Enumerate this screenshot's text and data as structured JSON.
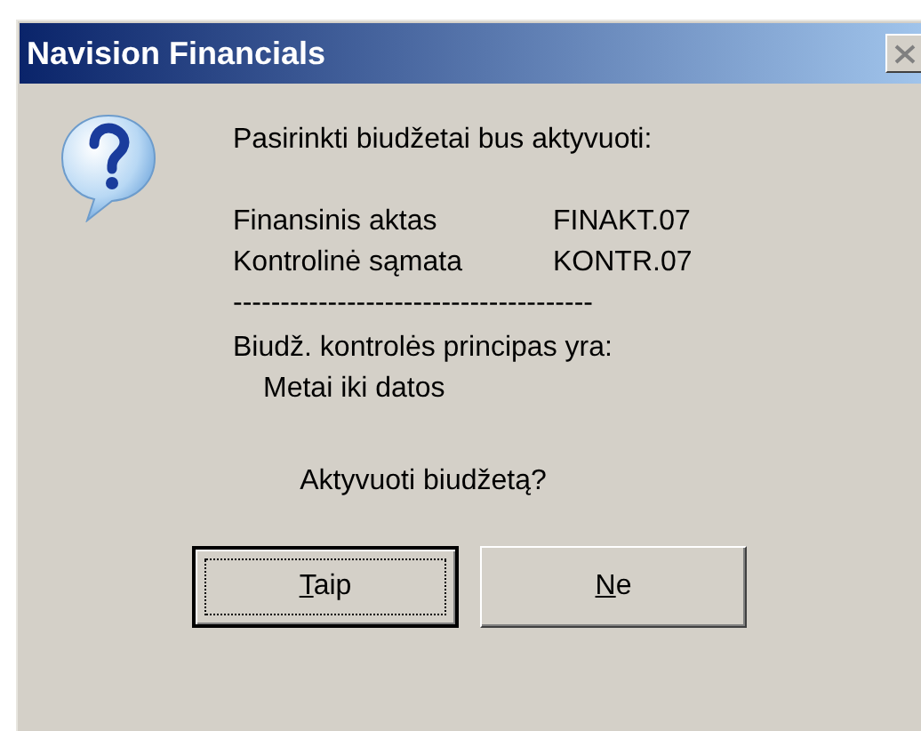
{
  "window": {
    "title": "Navision Financials"
  },
  "message": {
    "intro": "Pasirinkti biudžetai bus aktyvuoti:",
    "details": [
      {
        "label": "Finansinis aktas",
        "value": "FINAKT.07"
      },
      {
        "label": "Kontrolinė sąmata",
        "value": "KONTR.07"
      }
    ],
    "separator": "--------------------------------------",
    "principle_label": "Biudž. kontrolės principas yra:",
    "principle_value": "Metai iki datos",
    "question": "Aktyvuoti biudžetą?"
  },
  "buttons": [
    {
      "label": "Taip",
      "default": true,
      "underline_first": true
    },
    {
      "label": "Ne",
      "default": false,
      "underline_first": true
    }
  ]
}
